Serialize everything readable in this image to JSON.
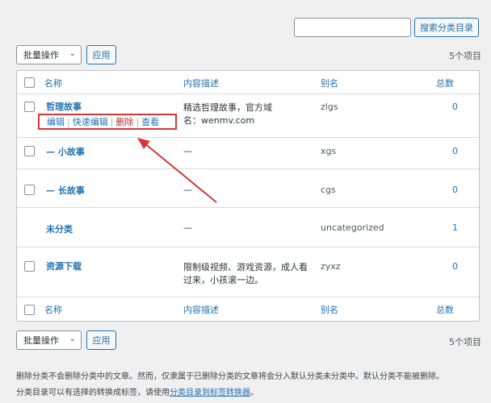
{
  "search": {
    "placeholder": "",
    "button_label": "搜索分类目录"
  },
  "top_bar": {
    "bulk_label": "批量操作",
    "apply_label": "应用",
    "count": "5个项目"
  },
  "bottom_bar": {
    "bulk_label": "批量操作",
    "apply_label": "应用",
    "count": "5个项目"
  },
  "columns": {
    "name": "名称",
    "description": "内容描述",
    "slug": "别名",
    "count": "总数"
  },
  "row_actions": {
    "edit": "编辑",
    "quick_edit": "快速编辑",
    "delete": "删除",
    "view": "查看",
    "sep": "|"
  },
  "rows": [
    {
      "name": "哲理故事",
      "desc1": "精选哲理故事，官方域",
      "desc2": "名：wenmv.com",
      "slug": "zlgs",
      "count": "0"
    },
    {
      "name": "— 小故事",
      "desc1": "—",
      "desc2": "",
      "slug": "xgs",
      "count": "0"
    },
    {
      "name": "— 长故事",
      "desc1": "—",
      "desc2": "",
      "slug": "cgs",
      "count": "0"
    },
    {
      "name": "未分类",
      "desc1": "—",
      "desc2": "",
      "slug": "uncategorized",
      "count": "1"
    },
    {
      "name": "资源下载",
      "desc1": "限制级视频、游戏资源，成人看",
      "desc2": "过来，小孩滚一边。",
      "slug": "zyxz",
      "count": "0"
    }
  ],
  "footer_note": {
    "line1": "删除分类不会删除分类中的文章。然而，仅隶属于已删除分类的文章将会分入默认分类未分类中。默认分类不能被删除。",
    "line2_prefix": "分类目录可以有选择的转换成标签，请使用",
    "line2_link": "分类目录到标签转换器",
    "line2_suffix": "。"
  },
  "colors": {
    "accent": "#2271b1",
    "highlight": "#d63638"
  }
}
